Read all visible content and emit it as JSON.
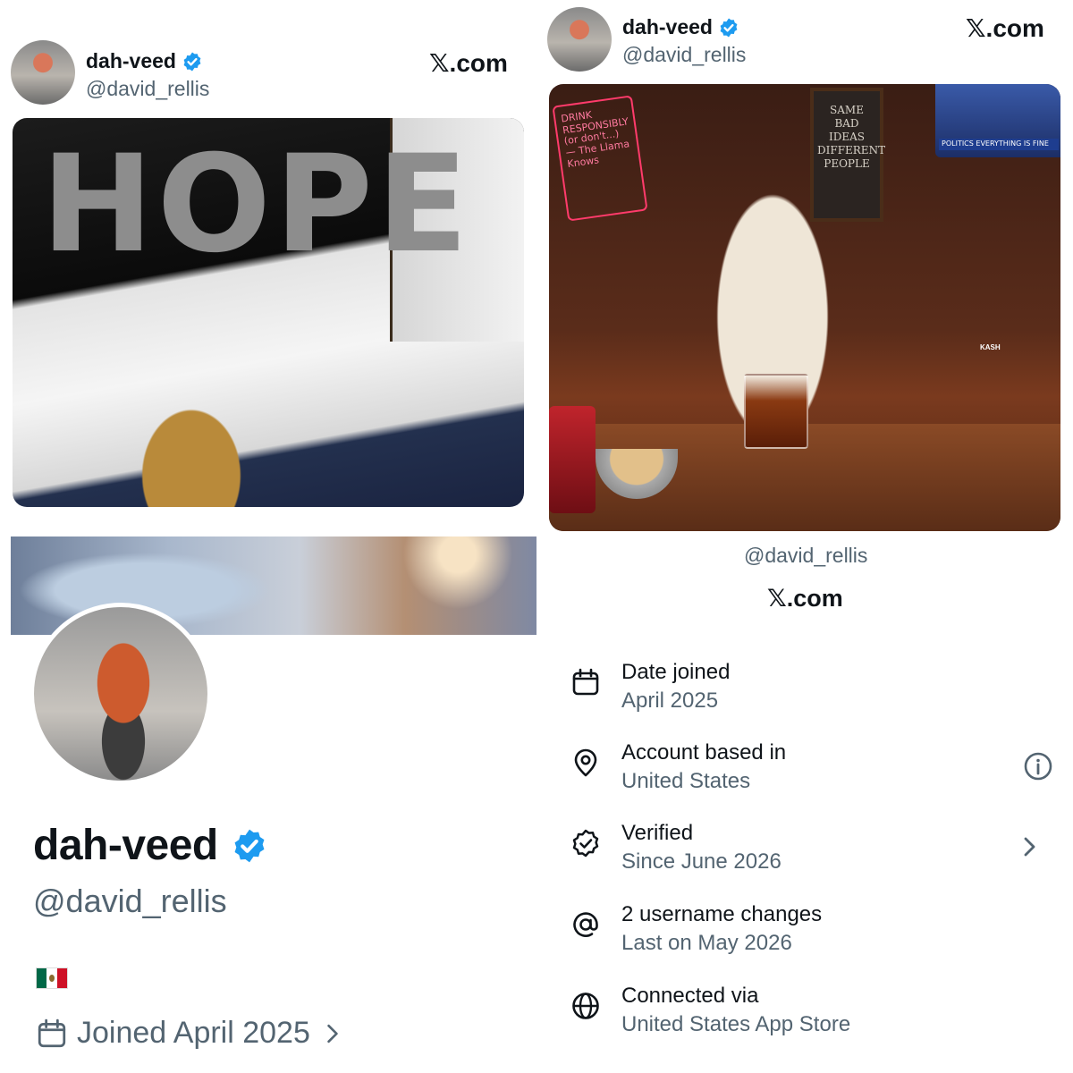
{
  "left_tweet": {
    "author_name": "dah-veed",
    "author_handle": "@david_rellis",
    "source": "𝕏.com",
    "image_text": "HOPE"
  },
  "right_tweet": {
    "author_name": "dah-veed",
    "author_handle": "@david_rellis",
    "source": "𝕏.com",
    "neon_sign_text": "DRINK RESPONSIBLY (or don't...) — The Llama Knows",
    "chalk_sign_text": "SAME BAD IDEAS DIFFERENT PEOPLE",
    "tv_text": "POLITICS EVERYTHING IS FINE",
    "pin_text": "KASH"
  },
  "profile": {
    "display_name": "dah-veed",
    "handle": "@david_rellis",
    "joined": "Joined April 2025"
  },
  "about": {
    "handle": "@david_rellis",
    "source": "𝕏.com",
    "rows": [
      {
        "title": "Date joined",
        "value": "April 2025",
        "icon": "calendar-icon"
      },
      {
        "title": "Account based in",
        "value": "United States",
        "icon": "location-pin-icon",
        "action": "info-icon"
      },
      {
        "title": "Verified",
        "value": "Since June 2026",
        "icon": "verified-icon",
        "action": "chevron-right-icon"
      },
      {
        "title": "2 username changes",
        "value": "Last on May 2026",
        "icon": "at-icon"
      },
      {
        "title": "Connected via",
        "value": "United States App Store",
        "icon": "globe-icon"
      }
    ]
  },
  "colors": {
    "verified_blue": "#1d9bf0",
    "text_primary": "#0f1419",
    "text_secondary": "#536471"
  }
}
